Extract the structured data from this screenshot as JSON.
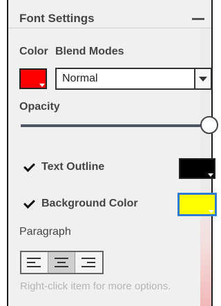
{
  "panel": {
    "title": "Font Settings",
    "color_label": "Color",
    "blend_label": "Blend Modes",
    "blend_value": "Normal",
    "opacity_label": "Opacity",
    "opacity_value": 1,
    "text_outline_label": "Text Outline",
    "background_color_label": "Background Color",
    "paragraph_label": "Paragraph",
    "footer_hint": "Right-click item for more options.",
    "text_color": "#ff0000",
    "text_outline_color": "#000000",
    "background_color": "#ffff00",
    "text_outline_checked": true,
    "background_color_checked": true,
    "active_alignment": "center"
  },
  "icons": {
    "collapse": "minus-icon",
    "dropdown": "chevron-down-icon",
    "align_left": "align-left-icon",
    "align_center": "align-center-icon",
    "align_right": "align-right-icon",
    "check": "checkmark-icon"
  }
}
